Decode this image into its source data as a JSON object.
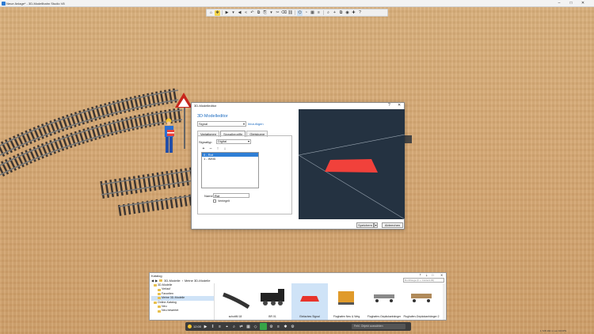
{
  "app": {
    "title": "Neue Anlage* - 3D-Modellbahn Studio V8",
    "controls": [
      "–",
      "□",
      "✕"
    ]
  },
  "toolbar": {
    "icons": [
      "home-icon",
      "move-icon",
      "camera-icon",
      "chevron-down-icon",
      "step-back-icon",
      "rewind-icon",
      "undo-icon",
      "copy-icon",
      "paste-icon",
      "chevron-down-icon",
      "cut-icon",
      "delete-icon",
      "link-icon",
      "view-icon",
      "view2-icon",
      "grid-icon",
      "layer-icon",
      "zoom-icon",
      "plus-icon",
      "clone-icon",
      "photo-icon",
      "plugin-icon",
      "help-icon"
    ],
    "glyphs": [
      "⌂",
      "✥",
      "▶",
      "▾",
      "◀",
      "«",
      "↶",
      "⧉",
      "⎘",
      "▾",
      "✂",
      "⌫",
      "⛓",
      "⌬",
      "◔",
      "▦",
      "≡",
      "⌕",
      "+",
      "⧉",
      "◉",
      "✚",
      "?"
    ]
  },
  "dialog": {
    "title": "3D-Modelleditor",
    "controls": [
      "?",
      "✕"
    ],
    "heading": "3D-Modelleditor",
    "type_value": "Signal",
    "add_link": "hinzufügen",
    "tabs": [
      "Variationen",
      "Signalbegriffe",
      "Gleiskurve"
    ],
    "active_tab": 1,
    "signal_type_label": "Signaltyp",
    "signal_type_value": "Digital",
    "list_tools": [
      "+",
      "–",
      "↑",
      "↓"
    ],
    "states": [
      "0 - Rot",
      "1 - Weiß"
    ],
    "selected_state": 0,
    "name_label": "Name",
    "name_value": "Rot",
    "checkbox_label": "Verriegelt",
    "save_button": "Speichern",
    "save_arrow": "▾",
    "cancel_button": "Abbrechen"
  },
  "catalog": {
    "title": "Katalog",
    "controls": [
      "⇡",
      "⇣",
      "□",
      "✕"
    ],
    "path": [
      "3D-Modelle",
      "Meine 3D-Modelle"
    ],
    "search_placeholder": "Durchsuge (F + Content-ID)",
    "tree": [
      {
        "label": "3D-Modelle",
        "indent": 1
      },
      {
        "label": "Verlauf",
        "indent": 2
      },
      {
        "label": "Favoriten",
        "indent": 2
      },
      {
        "label": "Meine 3D-Modelle",
        "indent": 2,
        "selected": true
      },
      {
        "label": "Online-Katalog",
        "indent": 1
      },
      {
        "label": "Neu",
        "indent": 2
      },
      {
        "label": "Neu bewertet",
        "indent": 2
      }
    ],
    "items": [
      {
        "label": "schottM 18",
        "selected": false
      },
      {
        "label": "BR 01",
        "selected": false
      },
      {
        "label": "Einfaches Signal",
        "selected": true
      },
      {
        "label": "Flughafen Neu & Weg.",
        "selected": false
      },
      {
        "label": "Flughafen-Gepäckanhänger",
        "selected": false
      },
      {
        "label": "Flughafen-Gepäckanhänger 2",
        "selected": false
      }
    ]
  },
  "bottombar": {
    "time": "12:00",
    "glyphs": [
      "▶",
      "‖",
      "≡",
      "⌖",
      "⌕",
      "⇄",
      "▦",
      "◇"
    ],
    "right_glyphs": [
      "⚙",
      "≡",
      "✱",
      "⚙"
    ],
    "search_placeholder": "Fehl. Objekt auswählen"
  },
  "status": {
    "text": "1 728 192 m von   60 FPS"
  }
}
